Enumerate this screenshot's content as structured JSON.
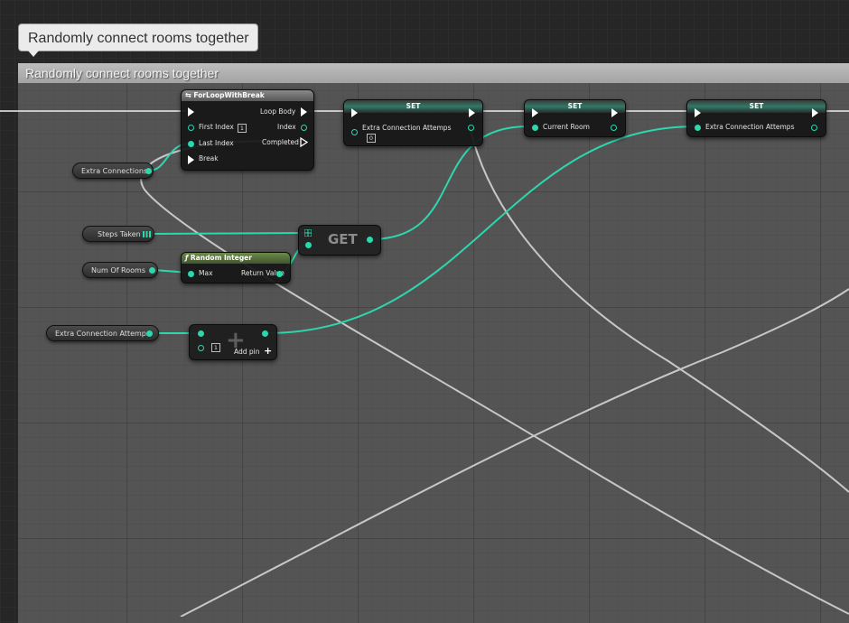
{
  "comment": {
    "bubble_text": "Randomly connect rooms together",
    "header_text": "Randomly connect rooms together"
  },
  "nodes": {
    "for_loop": {
      "title": "ForLoopWithBreak",
      "first_index_label": "First Index",
      "first_index_value": "1",
      "last_index_label": "Last Index",
      "break_label": "Break",
      "loop_body_label": "Loop Body",
      "index_label": "Index",
      "completed_label": "Completed"
    },
    "set1": {
      "title": "SET",
      "pin_label": "Extra Connection Attemps",
      "value": "0"
    },
    "set2": {
      "title": "SET",
      "pin_label": "Current Room"
    },
    "set3": {
      "title": "SET",
      "pin_label": "Extra Connection Attemps"
    },
    "get": {
      "title": "GET"
    },
    "random_integer": {
      "title": "Random Integer",
      "max_label": "Max",
      "return_label": "Return Value"
    },
    "add": {
      "value": "1",
      "add_pin_label": "Add pin"
    },
    "var_extra_connections": {
      "label": "Extra Connections"
    },
    "var_steps_taken": {
      "label": "Steps Taken"
    },
    "var_num_of_rooms": {
      "label": "Num Of Rooms"
    },
    "var_extra_connection_attemps": {
      "label": "Extra Connection Attemps"
    }
  },
  "colors": {
    "int_pin": "#2ed6ad",
    "exec_wire": "#ffffff",
    "comment_header": "#b0b0b0"
  }
}
